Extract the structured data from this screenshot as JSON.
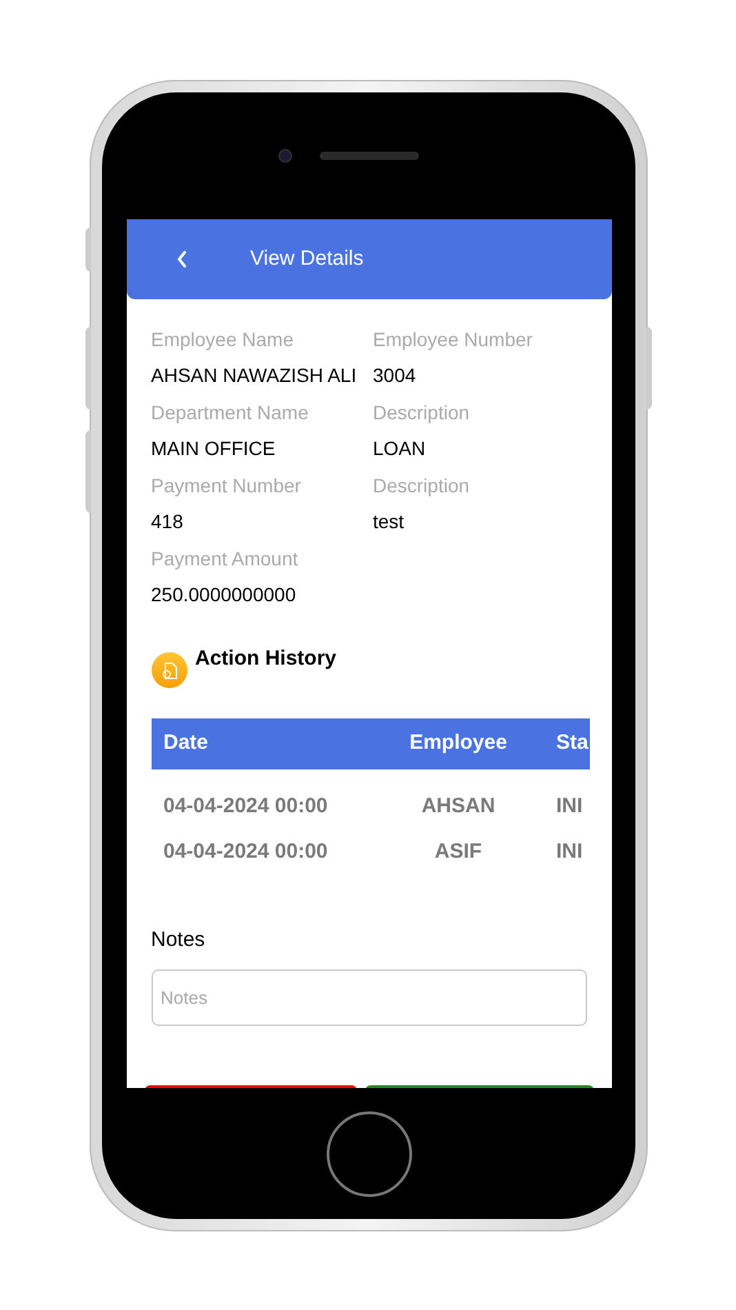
{
  "header": {
    "title": "View Details"
  },
  "fields": [
    {
      "label": "Employee Name",
      "value": "AHSAN NAWAZISH ALI"
    },
    {
      "label": "Employee Number",
      "value": "3004"
    },
    {
      "label": "Department Name",
      "value": "MAIN OFFICE"
    },
    {
      "label": "Description",
      "value": "LOAN"
    },
    {
      "label": "Payment Number",
      "value": "418"
    },
    {
      "label": "Description",
      "value": "test"
    },
    {
      "label": "Payment Amount",
      "value": "250.0000000000"
    }
  ],
  "action_history": {
    "title": "Action History",
    "columns": [
      "Date",
      "Employee",
      "Sta"
    ],
    "rows": [
      [
        "04-04-2024 00:00",
        "AHSAN",
        "INI"
      ],
      [
        "04-04-2024 00:00",
        "ASIF",
        "INI"
      ]
    ]
  },
  "notes": {
    "label": "Notes",
    "placeholder": "Notes"
  },
  "actions": [
    {
      "color": "#ff0000"
    },
    {
      "color": "#228b22"
    }
  ]
}
